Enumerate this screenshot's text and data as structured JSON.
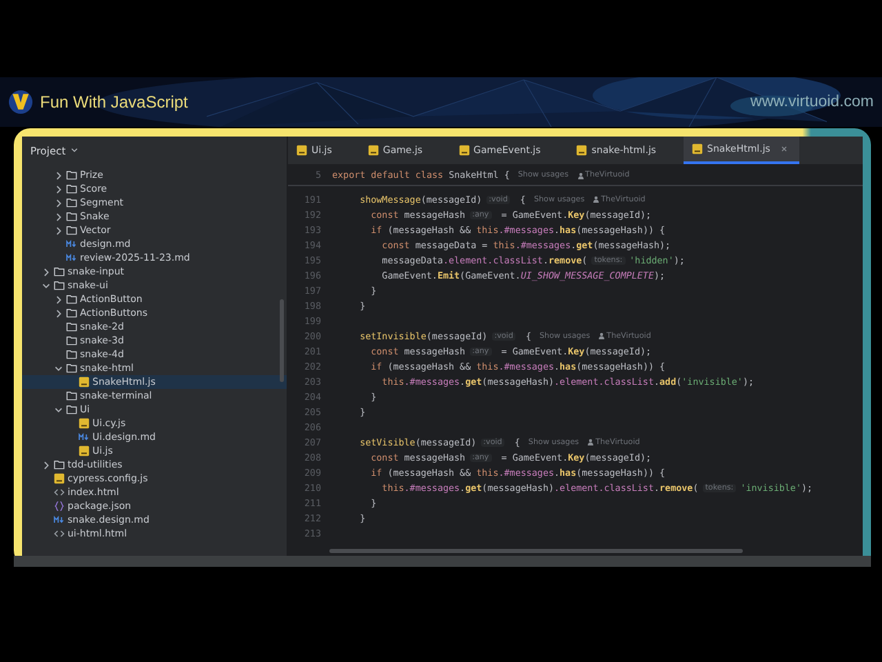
{
  "header": {
    "title": "Fun With JavaScript",
    "website": "www.virtuoid.com"
  },
  "project_panel": {
    "title": "Project",
    "tree": [
      {
        "children": [
          {
            "kind": "folder",
            "label": "Prize",
            "expanded": false
          },
          {
            "kind": "folder",
            "label": "Score",
            "expanded": false
          },
          {
            "kind": "folder",
            "label": "Segment",
            "expanded": false
          },
          {
            "kind": "folder",
            "label": "Snake",
            "expanded": false
          },
          {
            "kind": "folder",
            "label": "Vector",
            "expanded": false
          },
          {
            "kind": "md",
            "label": "design.md",
            "selected": false
          },
          {
            "kind": "md",
            "label": "review-2025-11-23.md",
            "selected": false
          }
        ]
      },
      {
        "kind": "folder",
        "label": "snake-input",
        "expanded": false
      },
      {
        "kind": "folder",
        "label": "snake-ui",
        "expanded": true,
        "children": [
          {
            "kind": "folder",
            "label": "ActionButton",
            "expanded": false
          },
          {
            "kind": "folder",
            "label": "ActionButtons",
            "expanded": false
          },
          {
            "kind": "folder",
            "label": "snake-2d"
          },
          {
            "kind": "folder",
            "label": "snake-3d"
          },
          {
            "kind": "folder",
            "label": "snake-4d"
          },
          {
            "kind": "folder",
            "label": "snake-html",
            "expanded": true,
            "children": [
              {
                "kind": "js",
                "label": "SnakeHtml.js",
                "selected": true
              }
            ]
          },
          {
            "kind": "folder",
            "label": "snake-terminal"
          },
          {
            "kind": "folder",
            "label": "Ui",
            "expanded": true,
            "children": [
              {
                "kind": "js",
                "label": "Ui.cy.js",
                "selected": false
              },
              {
                "kind": "md",
                "label": "Ui.design.md",
                "selected": false
              },
              {
                "kind": "js",
                "label": "Ui.js",
                "selected": false
              }
            ]
          }
        ]
      },
      {
        "kind": "folder",
        "label": "tdd-utilities",
        "expanded": false
      },
      {
        "kind": "js",
        "label": "cypress.config.js",
        "selected": false
      },
      {
        "kind": "html",
        "label": "index.html",
        "selected": false
      },
      {
        "kind": "json",
        "label": "package.json",
        "selected": false
      },
      {
        "kind": "md",
        "label": "snake.design.md",
        "selected": false
      },
      {
        "kind": "html",
        "label": "ui-html.html",
        "selected": false
      }
    ]
  },
  "tabs": [
    {
      "label": "Ui.js",
      "selected": false
    },
    {
      "label": "Game.js",
      "selected": false
    },
    {
      "label": "GameEvent.js",
      "selected": false
    },
    {
      "label": "snake-html.js",
      "selected": false
    },
    {
      "label": "SnakeHtml.js",
      "selected": true
    }
  ],
  "sticky_line": {
    "number": "5",
    "segments": [
      {
        "kind": "kw",
        "text": "export default class"
      },
      {
        "kind": "plain",
        "text": " SnakeHtml {"
      },
      {
        "kind": "usage",
        "text": "Show usages"
      },
      {
        "kind": "author",
        "text": "TheVirtuoid"
      }
    ]
  },
  "code_lines": [
    {
      "number": "191",
      "segments": [
        {
          "kind": "fn",
          "text": "  showMessage"
        },
        {
          "kind": "plain",
          "text": "(messageId)"
        },
        {
          "kind": "hint",
          "text": ":void"
        },
        {
          "kind": "plain",
          "text": " {"
        },
        {
          "kind": "usage",
          "text": "Show usages"
        },
        {
          "kind": "author",
          "text": "TheVirtuoid"
        }
      ]
    },
    {
      "number": "192",
      "segments": [
        {
          "kind": "kw",
          "text": "    const"
        },
        {
          "kind": "plain",
          "text": " messageHash"
        },
        {
          "kind": "hint",
          "text": ":any"
        },
        {
          "kind": "plain",
          "text": " = GameEvent."
        },
        {
          "kind": "method",
          "text": "Key"
        },
        {
          "kind": "plain",
          "text": "(messageId);"
        }
      ]
    },
    {
      "number": "193",
      "segments": [
        {
          "kind": "kw",
          "text": "    if"
        },
        {
          "kind": "plain",
          "text": " (messageHash && "
        },
        {
          "kind": "kw",
          "text": "this"
        },
        {
          "kind": "field",
          "text": ".#messages"
        },
        {
          "kind": "plain",
          "text": "."
        },
        {
          "kind": "method",
          "text": "has"
        },
        {
          "kind": "plain",
          "text": "(messageHash)) {"
        }
      ]
    },
    {
      "number": "194",
      "segments": [
        {
          "kind": "kw",
          "text": "      const"
        },
        {
          "kind": "plain",
          "text": " messageData = "
        },
        {
          "kind": "kw",
          "text": "this"
        },
        {
          "kind": "field",
          "text": ".#messages"
        },
        {
          "kind": "plain",
          "text": "."
        },
        {
          "kind": "method",
          "text": "get"
        },
        {
          "kind": "plain",
          "text": "(messageHash);"
        }
      ]
    },
    {
      "number": "195",
      "segments": [
        {
          "kind": "plain",
          "text": "      messageData"
        },
        {
          "kind": "field",
          "text": ".element.classList"
        },
        {
          "kind": "plain",
          "text": "."
        },
        {
          "kind": "method",
          "text": "remove"
        },
        {
          "kind": "plain",
          "text": "("
        },
        {
          "kind": "hint",
          "text": "tokens:"
        },
        {
          "kind": "str",
          "text": "'hidden'"
        },
        {
          "kind": "plain",
          "text": ");"
        }
      ]
    },
    {
      "number": "196",
      "segments": [
        {
          "kind": "plain",
          "text": "      GameEvent."
        },
        {
          "kind": "method",
          "text": "Emit"
        },
        {
          "kind": "plain",
          "text": "(GameEvent."
        },
        {
          "kind": "const",
          "text": "UI_SHOW_MESSAGE_COMPLETE"
        },
        {
          "kind": "plain",
          "text": ");"
        }
      ]
    },
    {
      "number": "197",
      "segments": [
        {
          "kind": "plain",
          "text": "    }"
        }
      ]
    },
    {
      "number": "198",
      "segments": [
        {
          "kind": "plain",
          "text": "  }"
        }
      ]
    },
    {
      "number": "199"
    },
    {
      "number": "200",
      "segments": [
        {
          "kind": "fn",
          "text": "  setInvisible"
        },
        {
          "kind": "plain",
          "text": "(messageId)"
        },
        {
          "kind": "hint",
          "text": ":void"
        },
        {
          "kind": "plain",
          "text": " {"
        },
        {
          "kind": "usage",
          "text": "Show usages"
        },
        {
          "kind": "author",
          "text": "TheVirtuoid"
        }
      ]
    },
    {
      "number": "201",
      "segments": [
        {
          "kind": "kw",
          "text": "    const"
        },
        {
          "kind": "plain",
          "text": " messageHash"
        },
        {
          "kind": "hint",
          "text": ":any"
        },
        {
          "kind": "plain",
          "text": " = GameEvent."
        },
        {
          "kind": "method",
          "text": "Key"
        },
        {
          "kind": "plain",
          "text": "(messageId);"
        }
      ]
    },
    {
      "number": "202",
      "segments": [
        {
          "kind": "kw",
          "text": "    if"
        },
        {
          "kind": "plain",
          "text": " (messageHash && "
        },
        {
          "kind": "kw",
          "text": "this"
        },
        {
          "kind": "field",
          "text": ".#messages"
        },
        {
          "kind": "plain",
          "text": "."
        },
        {
          "kind": "method",
          "text": "has"
        },
        {
          "kind": "plain",
          "text": "(messageHash)) {"
        }
      ]
    },
    {
      "number": "203",
      "segments": [
        {
          "kind": "kw",
          "text": "      this"
        },
        {
          "kind": "field",
          "text": ".#messages"
        },
        {
          "kind": "plain",
          "text": "."
        },
        {
          "kind": "method",
          "text": "get"
        },
        {
          "kind": "plain",
          "text": "(messageHash)"
        },
        {
          "kind": "field",
          "text": ".element.classList"
        },
        {
          "kind": "plain",
          "text": "."
        },
        {
          "kind": "method",
          "text": "add"
        },
        {
          "kind": "plain",
          "text": "("
        },
        {
          "kind": "str",
          "text": "'invisible'"
        },
        {
          "kind": "plain",
          "text": ");"
        }
      ]
    },
    {
      "number": "204",
      "segments": [
        {
          "kind": "plain",
          "text": "    }"
        }
      ]
    },
    {
      "number": "205",
      "segments": [
        {
          "kind": "plain",
          "text": "  }"
        }
      ]
    },
    {
      "number": "206"
    },
    {
      "number": "207",
      "segments": [
        {
          "kind": "fn",
          "text": "  setVisible"
        },
        {
          "kind": "plain",
          "text": "(messageId)"
        },
        {
          "kind": "hint",
          "text": ":void"
        },
        {
          "kind": "plain",
          "text": " {"
        },
        {
          "kind": "usage",
          "text": "Show usages"
        },
        {
          "kind": "author",
          "text": "TheVirtuoid"
        }
      ]
    },
    {
      "number": "208",
      "segments": [
        {
          "kind": "kw",
          "text": "    const"
        },
        {
          "kind": "plain",
          "text": " messageHash"
        },
        {
          "kind": "hint",
          "text": ":any"
        },
        {
          "kind": "plain",
          "text": " = GameEvent."
        },
        {
          "kind": "method",
          "text": "Key"
        },
        {
          "kind": "plain",
          "text": "(messageId);"
        }
      ]
    },
    {
      "number": "209",
      "segments": [
        {
          "kind": "kw",
          "text": "    if"
        },
        {
          "kind": "plain",
          "text": " (messageHash && "
        },
        {
          "kind": "kw",
          "text": "this"
        },
        {
          "kind": "field",
          "text": ".#messages"
        },
        {
          "kind": "plain",
          "text": "."
        },
        {
          "kind": "method",
          "text": "has"
        },
        {
          "kind": "plain",
          "text": "(messageHash)) {"
        }
      ]
    },
    {
      "number": "210",
      "segments": [
        {
          "kind": "kw",
          "text": "      this"
        },
        {
          "kind": "field",
          "text": ".#messages"
        },
        {
          "kind": "plain",
          "text": "."
        },
        {
          "kind": "method",
          "text": "get"
        },
        {
          "kind": "plain",
          "text": "(messageHash)"
        },
        {
          "kind": "field",
          "text": ".element.classList"
        },
        {
          "kind": "plain",
          "text": "."
        },
        {
          "kind": "method",
          "text": "remove"
        },
        {
          "kind": "plain",
          "text": "("
        },
        {
          "kind": "hint",
          "text": "tokens:"
        },
        {
          "kind": "str",
          "text": "'invisible'"
        },
        {
          "kind": "plain",
          "text": ");"
        }
      ]
    },
    {
      "number": "211",
      "segments": [
        {
          "kind": "plain",
          "text": "    }"
        }
      ]
    },
    {
      "number": "212",
      "segments": [
        {
          "kind": "plain",
          "text": "  }"
        }
      ]
    },
    {
      "number": "213"
    }
  ]
}
